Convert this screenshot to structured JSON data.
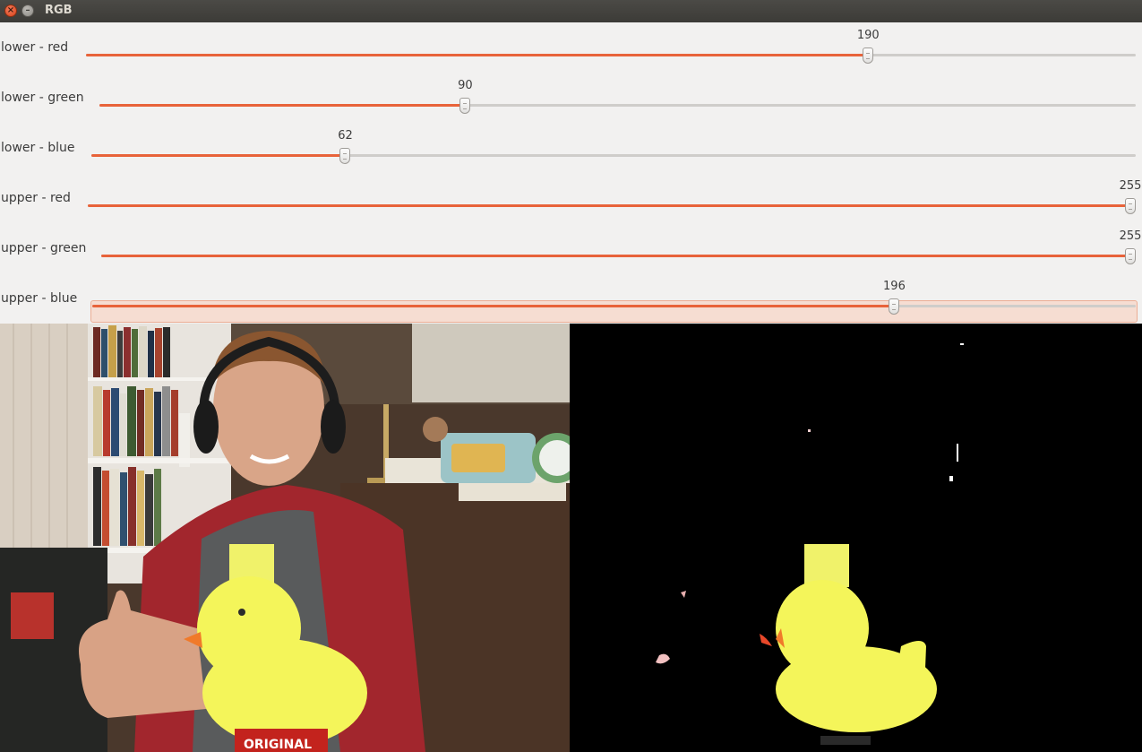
{
  "window": {
    "title": "RGB"
  },
  "sliders": [
    {
      "label": "lower - red",
      "value": 190,
      "max": 255
    },
    {
      "label": "lower - green",
      "value": 90,
      "max": 255
    },
    {
      "label": "lower - blue",
      "value": 62,
      "max": 255
    },
    {
      "label": "upper - red",
      "value": 255,
      "max": 255
    },
    {
      "label": "upper - green",
      "value": 255,
      "max": 255
    },
    {
      "label": "upper - blue",
      "value": 196,
      "max": 255
    }
  ],
  "focused_slider": 5,
  "camera_image": {
    "caption": "ORIGINAL"
  },
  "colors": {
    "accent": "#e8633a",
    "mask_background": "#000000",
    "duck_yellow": "#f4f55a"
  }
}
